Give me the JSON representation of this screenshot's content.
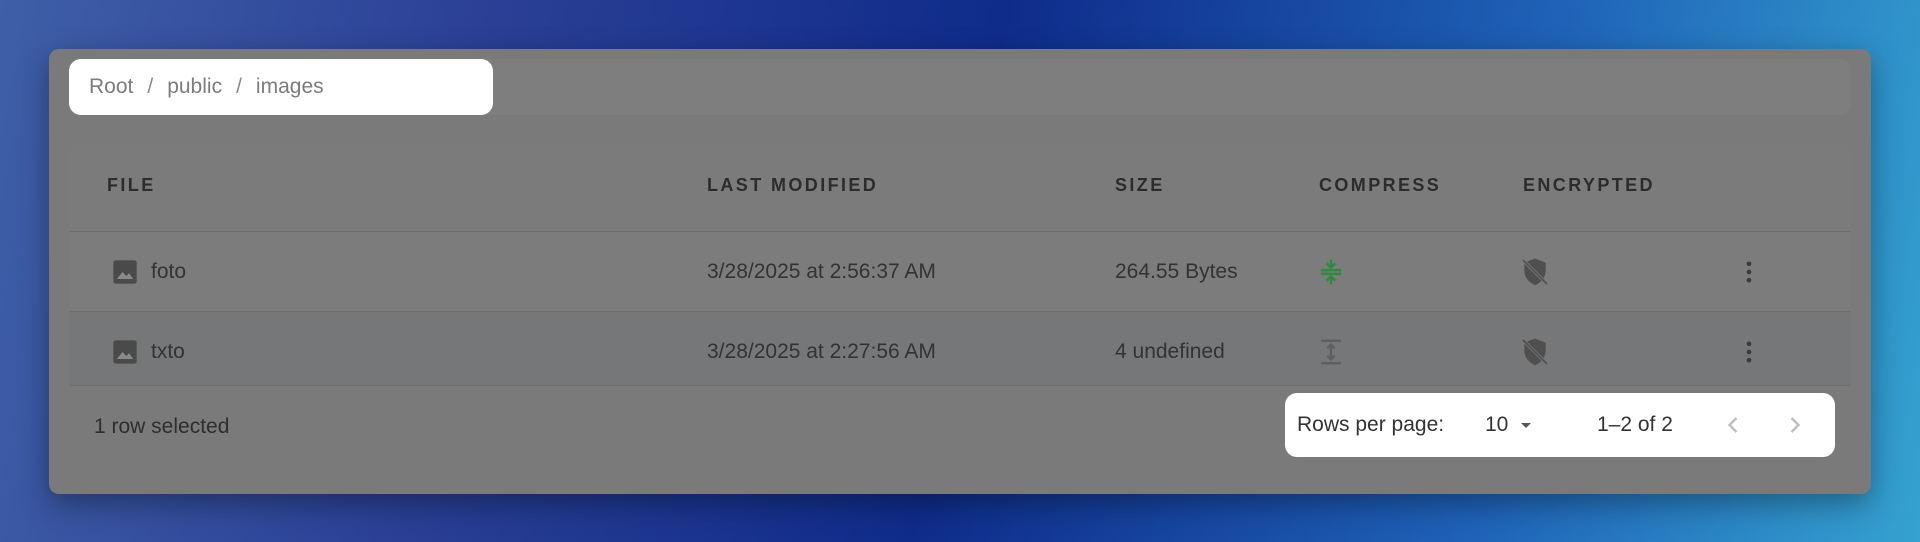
{
  "breadcrumb": {
    "items": [
      "Root",
      "public",
      "images"
    ],
    "separator": "/"
  },
  "table": {
    "columns": [
      "FILE",
      "LAST MODIFIED",
      "SIZE",
      "COMPRESS",
      "ENCRYPTED"
    ],
    "rows": [
      {
        "name": "foto",
        "modified": "3/28/2025 at 2:56:37 AM",
        "size": "264.55 Bytes",
        "compressed": true,
        "encrypted": false
      },
      {
        "name": "txto",
        "modified": "3/28/2025 at 2:27:56 AM",
        "size": "4 undefined",
        "compressed": false,
        "encrypted": false
      }
    ]
  },
  "footer": {
    "selection_text": "1 row selected",
    "rows_per_page_label": "Rows per page:",
    "rows_per_page_value": "10",
    "range_text": "1–2 of 2"
  },
  "icons": {
    "file": "image-icon",
    "compress_active": "compress-icon",
    "compress_inactive": "expand-icon",
    "encryption": "shield-off-icon",
    "menu": "more-vert-icon"
  },
  "colors": {
    "compress_active": "#2e8b3e",
    "icon_muted": "#4f4f4f",
    "overlay": "#7a7a7a"
  }
}
